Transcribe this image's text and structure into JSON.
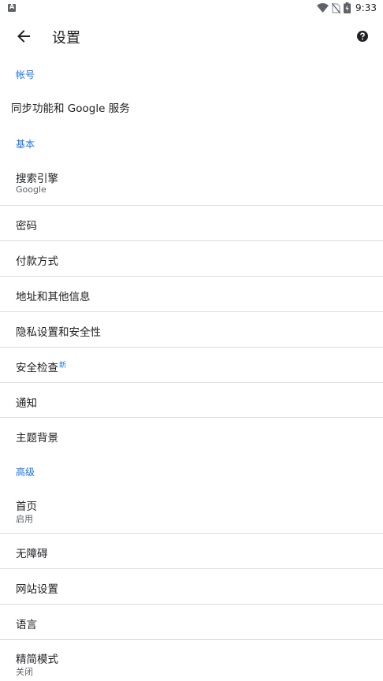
{
  "status": {
    "time": "9:33",
    "left_icon": "a-icon"
  },
  "header": {
    "title": "设置",
    "back_icon": "back-arrow-icon",
    "help_icon": "help-icon"
  },
  "sections": {
    "account": "帐号",
    "basic": "基本",
    "advanced": "高级"
  },
  "items": {
    "sync": "同步功能和 Google 服务",
    "search_engine": {
      "title": "搜索引擎",
      "sub": "Google"
    },
    "passwords": "密码",
    "payment": "付款方式",
    "addresses": "地址和其他信息",
    "privacy": "隐私设置和安全性",
    "safety_check": {
      "title": "安全检查",
      "badge": "新"
    },
    "notifications": "通知",
    "theme": "主题背景",
    "homepage": {
      "title": "首页",
      "sub": "启用"
    },
    "accessibility": "无障碍",
    "site_settings": "网站设置",
    "languages": "语言",
    "lite_mode": {
      "title": "精简模式",
      "sub": "关闭"
    }
  },
  "colors": {
    "accent": "#1a73e8",
    "text_primary": "#202124",
    "text_secondary": "#5f6368",
    "divider": "#dadce0"
  }
}
